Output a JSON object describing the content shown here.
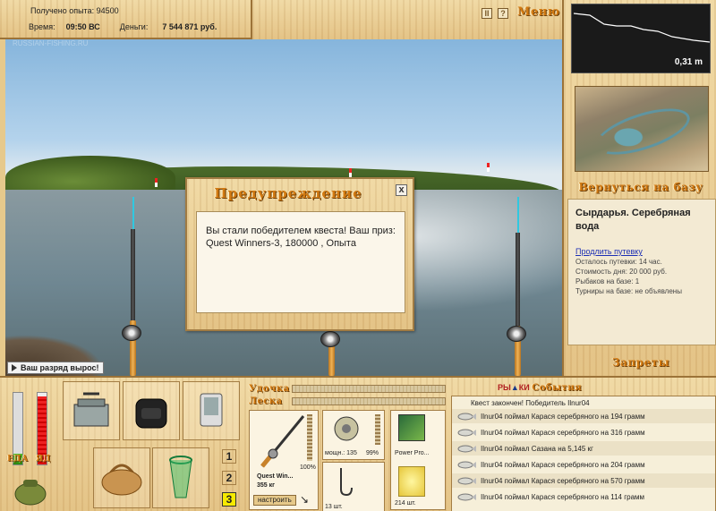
{
  "info": {
    "exp_label": "Получено опыта: 94500",
    "time_label": "Время:",
    "time_value": "09:50 ВС",
    "money_label": "Деньги:",
    "money_value": "7 544 871 руб."
  },
  "topbar": {
    "pause_glyph": "II",
    "help_glyph": "?",
    "menu_label": "Меню"
  },
  "scene": {
    "watermark": "RUSSIAN-FISHING.RU",
    "toast": "Ваш разряд вырос!"
  },
  "depth_map": {
    "depth": "0,31 m"
  },
  "location": {
    "back_to_base": "Вернуться на базу",
    "name": "Сырдарья. Серебряная вода",
    "extend_link": "Продлить путевку",
    "lines": [
      "Осталось путевки: 14 час.",
      "Стоимость дня: 20 000 руб.",
      "Рыбаков на базе: 1",
      "Турниры на базе: не объявлены"
    ],
    "bans": "Запреты"
  },
  "dialog": {
    "title": "Предупреждение",
    "close": "x",
    "text": "Вы стали победителем квеста! Ваш приз: Quest Winners-3, 180000 , Опыта"
  },
  "bottom": {
    "food_label": "ЕДА",
    "poison_label": "ЯД",
    "food_level": 0.15,
    "poison_level": 0.95,
    "group_buttons": [
      "1",
      "2",
      "3"
    ],
    "tackle": {
      "rod_label": "Удочка",
      "line_label": "Леска",
      "rod_name": "Quest Win...",
      "rod_weight": "355 кг",
      "rod_pct": "100%",
      "reel_caption": "мощн.: 135",
      "reel_pct": "99%",
      "hook_count": "13 шт.",
      "bait_name": "Power Pro...",
      "bait_count": "214 шт.",
      "setup_button": "настроить"
    },
    "events_title_a": "РЫ",
    "events_title_b": "КИ",
    "events_title_c": "События",
    "quest_line": "Квест закончен! Победитель Ilnur04",
    "events": [
      "Ilnur04 поймал Карася серебряного на 194 грамм",
      "Ilnur04 поймал Карася серебряного на 316 грамм",
      "Ilnur04 поймал Сазана на 5,145 кг",
      "Ilnur04 поймал Карася серебряного на 204 грамм",
      "Ilnur04 поймал Карася серебряного на 570 грамм",
      "Ilnur04 поймал Карася серебряного на 114 грамм"
    ]
  },
  "colors": {
    "wood": "#e8c98a",
    "accent_orange": "#d27a12",
    "link_blue": "#1c2fb5",
    "active_slot": "#f6ea00"
  }
}
